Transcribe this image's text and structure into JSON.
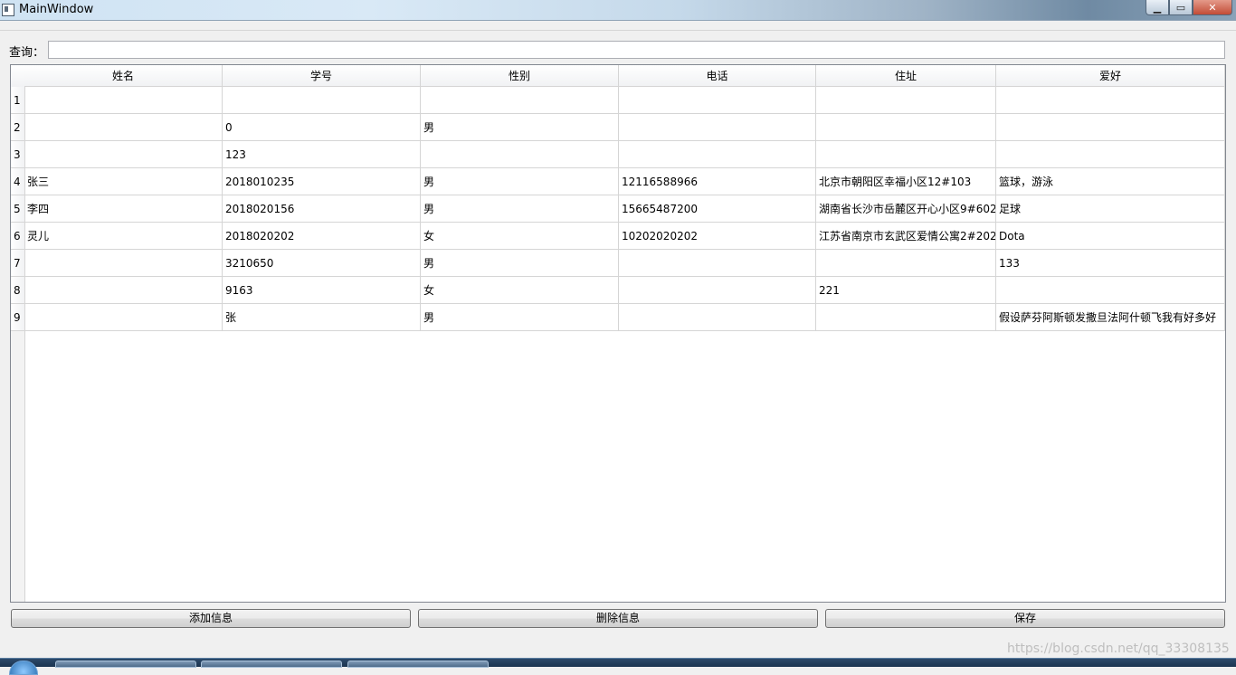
{
  "window": {
    "title": "MainWindow",
    "min_glyph": "▁",
    "max_glyph": "▭",
    "close_glyph": "✕"
  },
  "query": {
    "label": "查询：",
    "value": "",
    "placeholder": ""
  },
  "table": {
    "columns": [
      "姓名",
      "学号",
      "性别",
      "电话",
      "住址",
      "爱好"
    ],
    "rows": [
      {
        "num": "1",
        "cells": [
          "",
          "",
          "",
          "",
          "",
          ""
        ]
      },
      {
        "num": "2",
        "cells": [
          "",
          "0",
          "男",
          "",
          "",
          ""
        ]
      },
      {
        "num": "3",
        "cells": [
          "",
          "123",
          "",
          "",
          "",
          ""
        ]
      },
      {
        "num": "4",
        "cells": [
          "张三",
          "2018010235",
          "男",
          "12116588966",
          "北京市朝阳区幸福小区12#103",
          "篮球，游泳"
        ]
      },
      {
        "num": "5",
        "cells": [
          "李四",
          "2018020156",
          "男",
          "15665487200",
          "湖南省长沙市岳麓区开心小区9#602",
          "足球"
        ]
      },
      {
        "num": "6",
        "cells": [
          "灵儿",
          "2018020202",
          "女",
          "10202020202",
          "江苏省南京市玄武区爱情公寓2#202",
          "Dota"
        ]
      },
      {
        "num": "7",
        "cells": [
          "",
          "3210650",
          "男",
          "",
          "",
          "133"
        ]
      },
      {
        "num": "8",
        "cells": [
          "",
          "9163",
          "女",
          "",
          "221",
          ""
        ]
      },
      {
        "num": "9",
        "cells": [
          "",
          "张",
          "男",
          "",
          "",
          "假设萨芬阿斯顿发撒旦法阿什顿飞我有好多好"
        ]
      }
    ]
  },
  "buttons": {
    "add": "添加信息",
    "delete": "删除信息",
    "save": "保存"
  },
  "watermark": "https://blog.csdn.net/qq_33308135"
}
